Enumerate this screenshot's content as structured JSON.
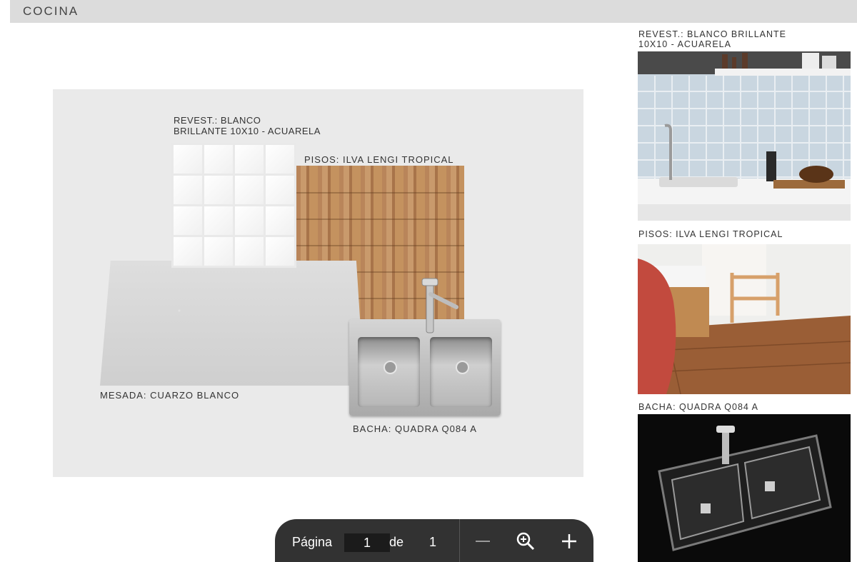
{
  "header": {
    "title": "COCINA"
  },
  "board": {
    "tiles_label_line1": "REVEST.: BLANCO",
    "tiles_label_line2": "BRILLANTE 10X10 - ACUARELA",
    "floor_label": "PISOS: ILVA LENGI TROPICAL",
    "counter_label": "MESADA: CUARZO BLANCO",
    "sink_label": "BACHA: QUADRA Q084 A"
  },
  "sidebar": {
    "items": [
      {
        "label_line1": "REVEST.: BLANCO BRILLANTE",
        "label_line2": "10X10 - ACUARELA"
      },
      {
        "label_line1": "PISOS: ILVA LENGI TROPICAL"
      },
      {
        "label_line1": "BACHA: QUADRA Q084 A"
      }
    ]
  },
  "viewer": {
    "page_label": "Página",
    "current_page": "1",
    "of_label": "de",
    "total_pages": "1",
    "zoom_out_icon": "minus-icon",
    "zoom_icon": "magnifier-icon",
    "zoom_in_icon": "plus-icon"
  }
}
